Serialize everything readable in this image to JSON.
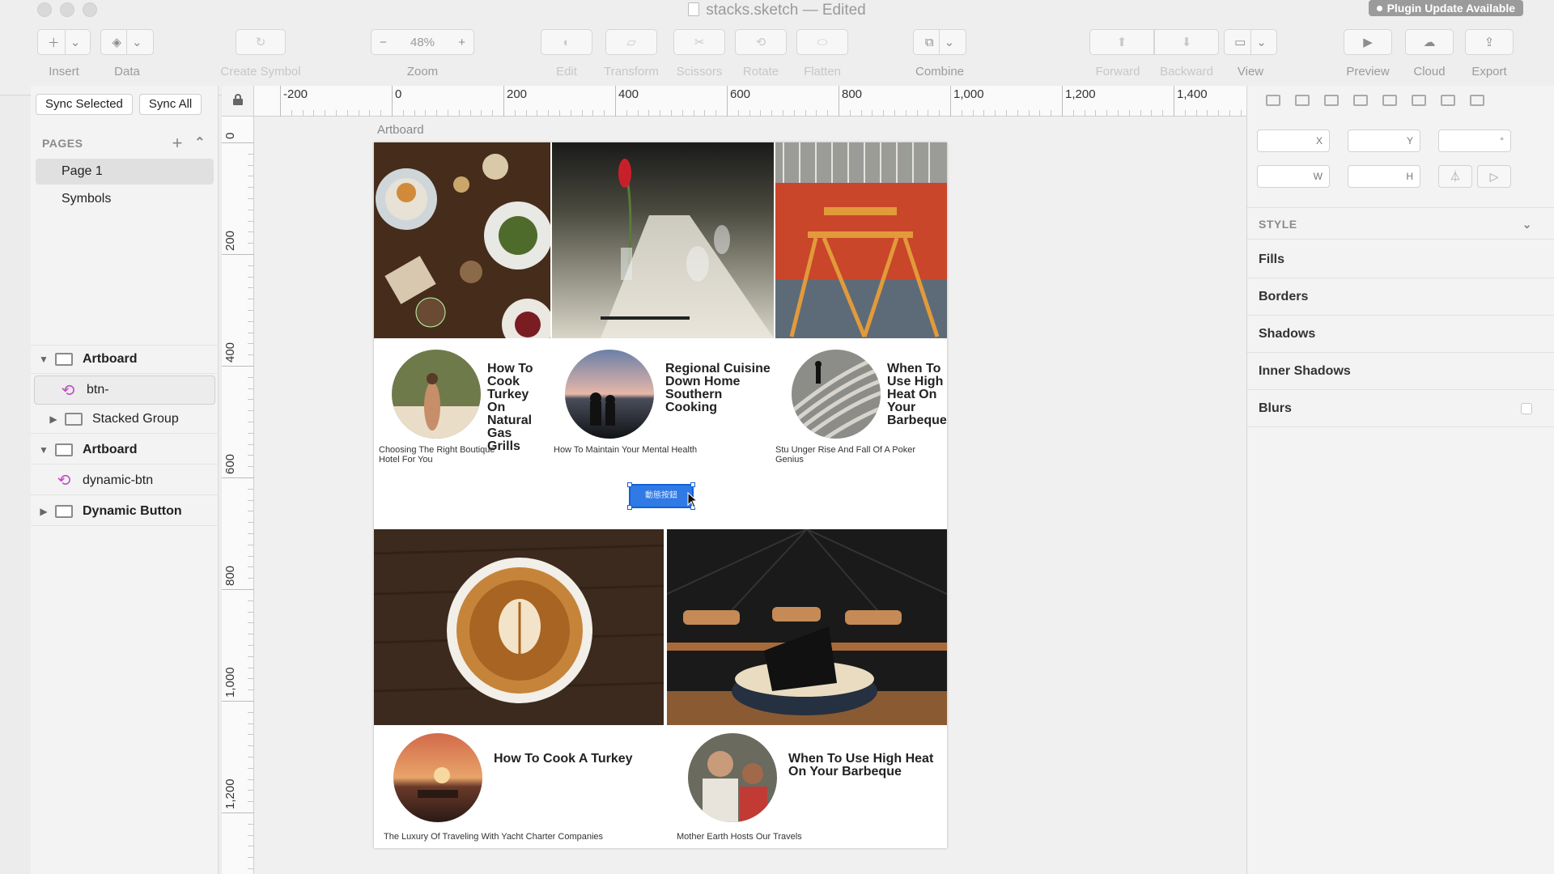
{
  "window": {
    "title": "stacks.sketch — Edited",
    "plugin_badge": "Plugin Update Available"
  },
  "toolbar": {
    "insert": "Insert",
    "data": "Data",
    "create_symbol": "Create Symbol",
    "zoom_label": "Zoom",
    "zoom_value": "48%",
    "zoom_minus": "−",
    "zoom_plus": "+",
    "edit": "Edit",
    "transform": "Transform",
    "scissors": "Scissors",
    "rotate": "Rotate",
    "flatten": "Flatten",
    "combine": "Combine",
    "forward": "Forward",
    "backward": "Backward",
    "view": "View",
    "preview": "Preview",
    "cloud": "Cloud",
    "export": "Export"
  },
  "left_panel": {
    "sync_selected": "Sync Selected",
    "sync_all": "Sync All",
    "pages_header": "PAGES",
    "pages": [
      "Page 1",
      "Symbols"
    ],
    "selected_page": "Page 1",
    "layers": [
      {
        "label": "Artboard",
        "type": "artboard"
      },
      {
        "label": "btn-",
        "type": "symbol"
      },
      {
        "label": "Stacked Group",
        "type": "group"
      },
      {
        "label": "Artboard",
        "type": "artboard"
      },
      {
        "label": "dynamic-btn",
        "type": "symbol"
      },
      {
        "label": "Dynamic Button",
        "type": "artboard"
      }
    ]
  },
  "rulers": {
    "horizontal": [
      "-200",
      "0",
      "200",
      "400",
      "600",
      "800",
      "1,000",
      "1,200",
      "1,400"
    ],
    "vertical": [
      "0",
      "200",
      "400",
      "600",
      "800",
      "1,000",
      "1,200"
    ]
  },
  "canvas": {
    "artboard_label": "Artboard",
    "cards_top": [
      {
        "title": "How To Cook Turkey On Natural Gas Grills",
        "subtitle": "Choosing The Right Boutique Hotel For You"
      },
      {
        "title": "Regional Cuisine Down Home Southern Cooking",
        "subtitle": "How To Maintain Your Mental Health"
      },
      {
        "title": "When To Use High Heat On Your Barbeque",
        "subtitle": "Stu Unger Rise And Fall Of A Poker Genius"
      }
    ],
    "dynamic_button_label": "動態按鈕",
    "cards_bottom": [
      {
        "title": "How To Cook A Turkey",
        "subtitle": "The Luxury Of Traveling With Yacht Charter Companies"
      },
      {
        "title": "When To Use High Heat On Your Barbeque",
        "subtitle": "Mother Earth Hosts Our Travels"
      }
    ]
  },
  "inspector": {
    "x_label": "X",
    "y_label": "Y",
    "rotation_label": "°",
    "w_label": "W",
    "h_label": "H",
    "style_header": "STYLE",
    "style_rows": [
      "Fills",
      "Borders",
      "Shadows",
      "Inner Shadows",
      "Blurs"
    ]
  },
  "colors": {
    "selection_blue": "#2f7ae5",
    "symbol_purple": "#c24cc9"
  }
}
